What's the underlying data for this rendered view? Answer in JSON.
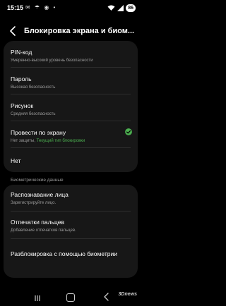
{
  "status": {
    "time": "15:15",
    "left_icons": "✉ ☂ ◉ •",
    "battery": "86"
  },
  "header": {
    "title": "Блокировка экрана и биом..."
  },
  "lock_options": [
    {
      "title": "PIN-код",
      "subtitle": "Умеренно-высокий уровень безопасности"
    },
    {
      "title": "Пароль",
      "subtitle": "Высокая безопасность"
    },
    {
      "title": "Рисунок",
      "subtitle": "Средняя безопасность"
    },
    {
      "title": "Провести по экрану",
      "subtitle": "Нет защиты,",
      "subtitle_accent": "Текущий тип блокировки"
    },
    {
      "title": "Нет"
    }
  ],
  "biometrics": {
    "section_label": "Биометрические данные",
    "items": [
      {
        "title": "Распознавание лица",
        "subtitle": "Зарегистрируйте лицо."
      },
      {
        "title": "Отпечатки пальцев",
        "subtitle": "Добавление отпечатков пальцев."
      },
      {
        "title": "Разблокировка с помощью биометрии"
      }
    ]
  },
  "watermark": "3Dnews",
  "colors": {
    "accent": "#4caf50",
    "card": "#171717",
    "background": "#000000"
  }
}
